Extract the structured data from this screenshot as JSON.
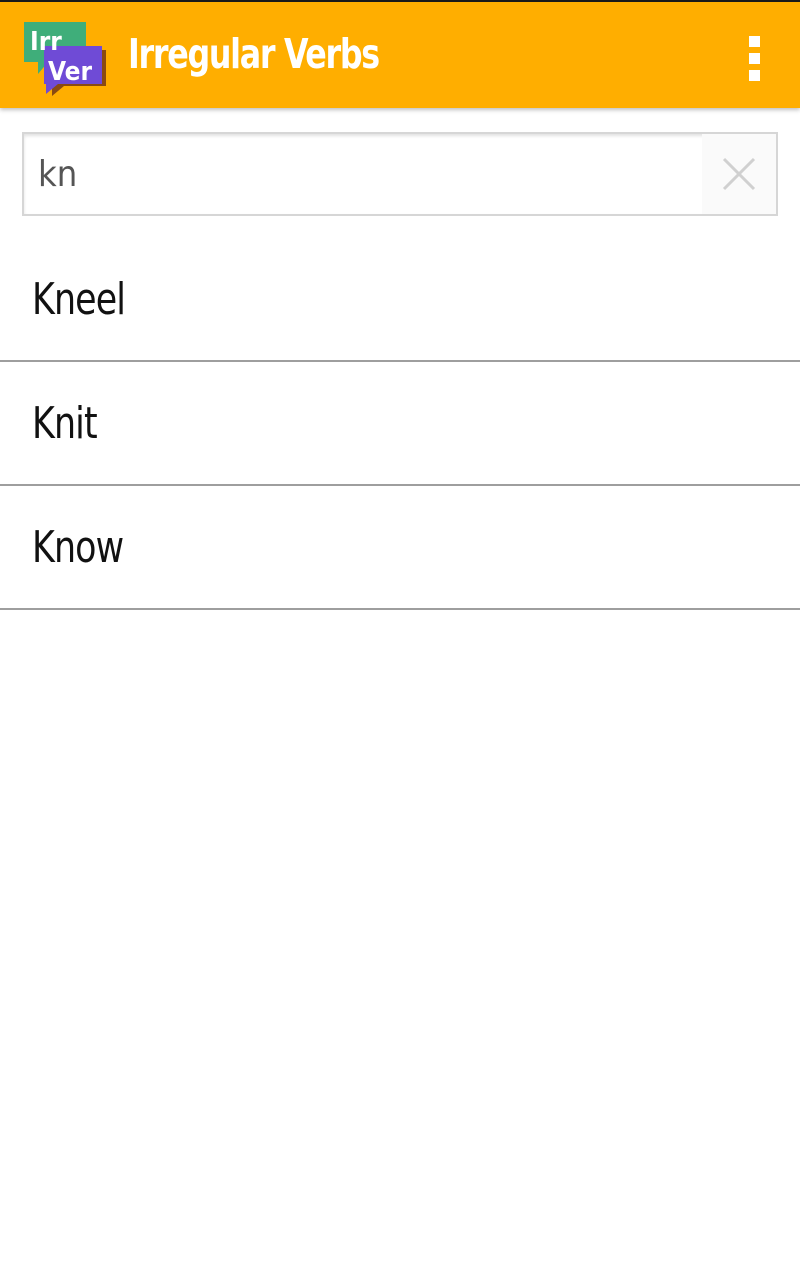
{
  "app": {
    "title": "Irregular Verbs",
    "logo_top_text": "Irr",
    "logo_bottom_text": "Ver",
    "accent_color": "#FFAE00"
  },
  "search": {
    "value": "kn",
    "placeholder": ""
  },
  "results": [
    {
      "label": "Kneel"
    },
    {
      "label": "Knit"
    },
    {
      "label": "Know"
    }
  ],
  "icons": {
    "menu": "overflow-menu-icon",
    "clear": "close-icon"
  }
}
